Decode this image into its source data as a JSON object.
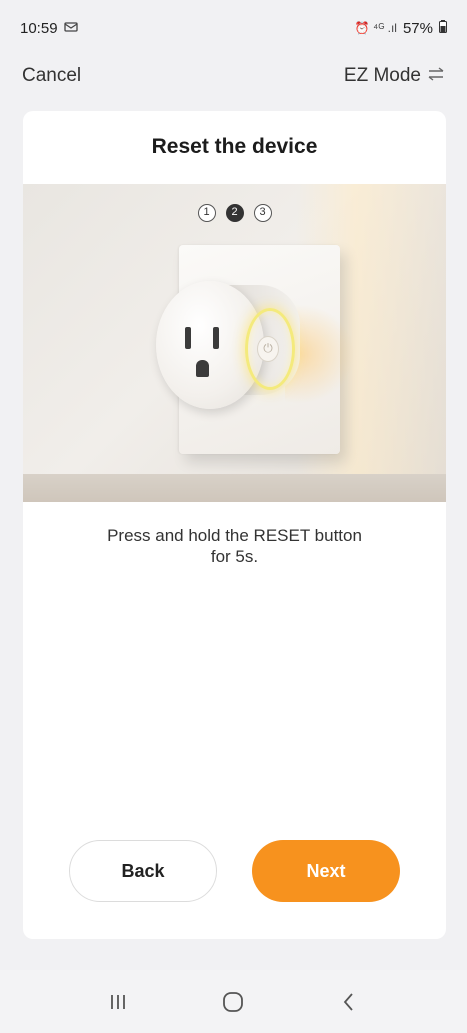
{
  "status_bar": {
    "time": "10:59",
    "left_icon": "notification-icon",
    "right_glyphs": "⏰ ⁴ᴳ .ıl",
    "battery": "57%"
  },
  "nav": {
    "cancel_label": "Cancel",
    "mode_label": "EZ Mode",
    "mode_icon": "swap-icon"
  },
  "card": {
    "title": "Reset the device",
    "steps": [
      "1",
      "2",
      "3"
    ],
    "active_step": 2,
    "instruction_line1": "Press and hold the RESET button",
    "instruction_line2": "for 5s."
  },
  "buttons": {
    "back_label": "Back",
    "next_label": "Next",
    "next_color": "#f7921e"
  },
  "android_nav": {
    "recents_icon": "recents-icon",
    "home_icon": "home-icon",
    "back_icon": "back-chevron-icon"
  }
}
